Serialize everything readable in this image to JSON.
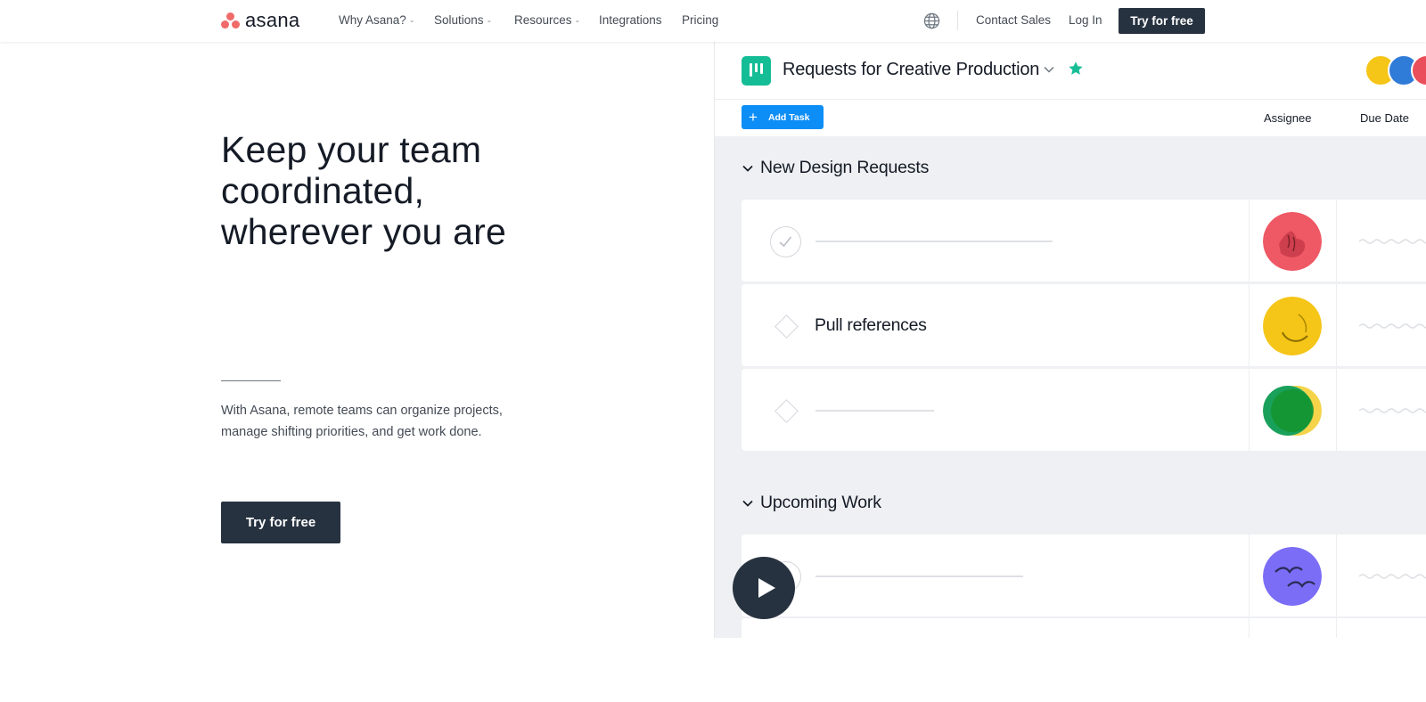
{
  "nav": {
    "logo_text": "asana",
    "links": [
      {
        "label": "Why Asana?",
        "dropdown": true
      },
      {
        "label": "Solutions",
        "dropdown": true
      },
      {
        "label": "Resources",
        "dropdown": true
      },
      {
        "label": "Integrations",
        "dropdown": false
      },
      {
        "label": "Pricing",
        "dropdown": false
      }
    ],
    "globe_icon": "globe-icon",
    "contact_sales": "Contact Sales",
    "log_in": "Log In",
    "try_for_free": "Try for free"
  },
  "hero": {
    "title_line_1": "Keep your team",
    "title_line_2": "coordinated,",
    "title_line_3": "wherever you are",
    "description_line_1": "With Asana, remote teams can organize projects,",
    "description_line_2": "manage shifting priorities, and get work done.",
    "cta": "Try for free"
  },
  "project": {
    "title": "Requests for Creative Production",
    "add_task": "Add Task",
    "columns": {
      "assignee": "Assignee",
      "due_date": "Due Date"
    },
    "sections": [
      {
        "name": "New Design Requests",
        "tasks": [
          {
            "name": "",
            "kind": "circle",
            "avatar": "red"
          },
          {
            "name": "Pull references",
            "kind": "diamond",
            "avatar": "yellow"
          },
          {
            "name": "",
            "kind": "diamond",
            "avatar": "green"
          }
        ]
      },
      {
        "name": "Upcoming Work",
        "tasks": [
          {
            "name": "",
            "kind": "circle",
            "avatar": "purple"
          }
        ]
      }
    ]
  },
  "colors": {
    "brand_coral": "#f06a6a",
    "dark_navy": "#273240",
    "project_teal": "#15bd96",
    "add_task_blue": "#0d8ef7"
  }
}
